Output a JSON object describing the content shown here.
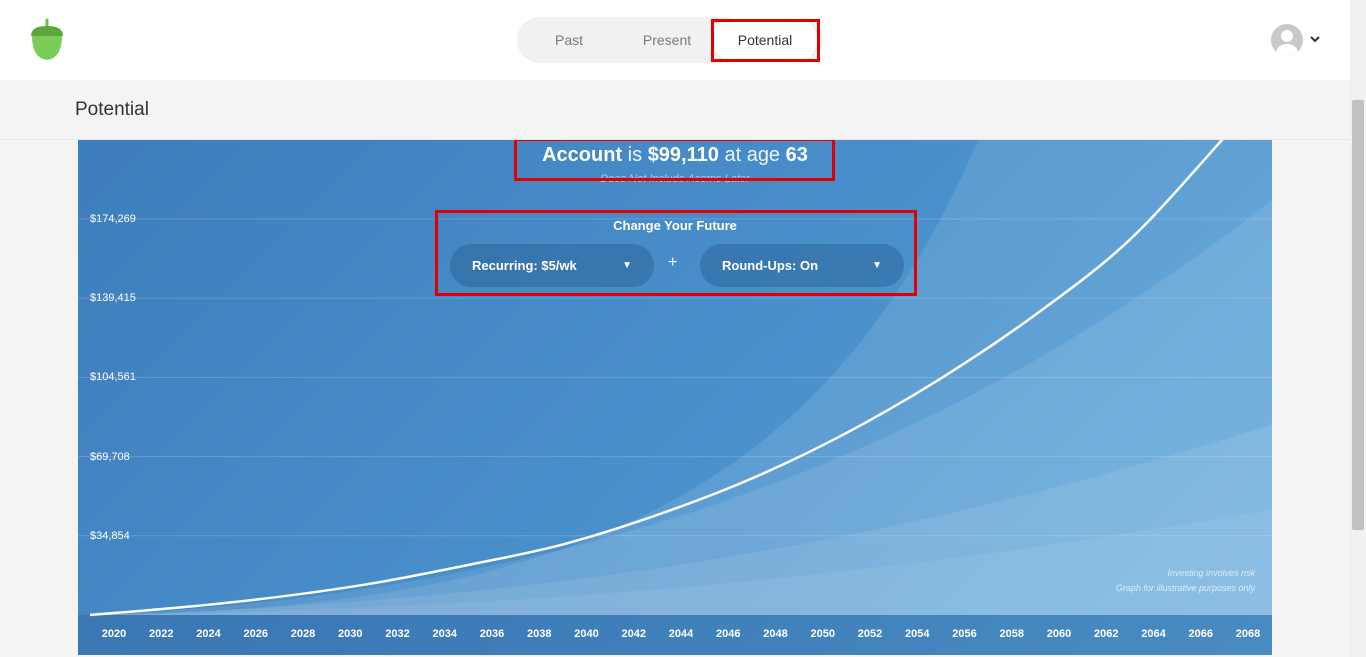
{
  "nav": {
    "tabs": [
      {
        "label": "Past"
      },
      {
        "label": "Present"
      },
      {
        "label": "Potential"
      }
    ],
    "active_tab": "Potential"
  },
  "page": {
    "title": "Potential"
  },
  "summary": {
    "account_word": "Account",
    "is_word": "is",
    "amount": "$99,110",
    "at_age_text": "at age",
    "age": "63",
    "subtitle": "Does Not Include Acorns Later"
  },
  "controls": {
    "heading": "Change Your Future",
    "recurring_label": "Recurring: $5/wk",
    "plus": "+",
    "roundups_label": "Round-Ups: On"
  },
  "notes": {
    "line1": "Investing involves risk",
    "line2": "Graph for illustrative purposes only"
  },
  "colors": {
    "brand_green": "#6cc04a",
    "chart_blue": "#4a91cc",
    "highlight_red": "#e10000"
  },
  "icons": {
    "logo": "acorn-logo-icon",
    "avatar": "user-avatar-icon",
    "caret": "chevron-down-icon"
  },
  "chart_data": {
    "type": "area",
    "y_ticks": [
      "$174,269",
      "$139,415",
      "$104,561",
      "$69,708",
      "$34,854"
    ],
    "y_tick_values": [
      174269,
      139415,
      104561,
      69708,
      34854
    ],
    "x_ticks": [
      "2020",
      "2022",
      "2024",
      "2026",
      "2028",
      "2030",
      "2032",
      "2034",
      "2036",
      "2038",
      "2040",
      "2042",
      "2044",
      "2046",
      "2048",
      "2050",
      "2052",
      "2054",
      "2056",
      "2058",
      "2060",
      "2062",
      "2064",
      "2066",
      "2068"
    ],
    "ylim": [
      0,
      209000
    ],
    "series": [
      {
        "x": [
          2020,
          2024,
          2028,
          2032,
          2036,
          2040,
          2044,
          2048,
          2052,
          2056,
          2060,
          2064,
          2068
        ],
        "values": [
          0,
          3500,
          8000,
          14000,
          22000,
          31000,
          44000,
          60000,
          80000,
          104000,
          132000,
          165000,
          210000
        ]
      }
    ],
    "grid": true
  }
}
